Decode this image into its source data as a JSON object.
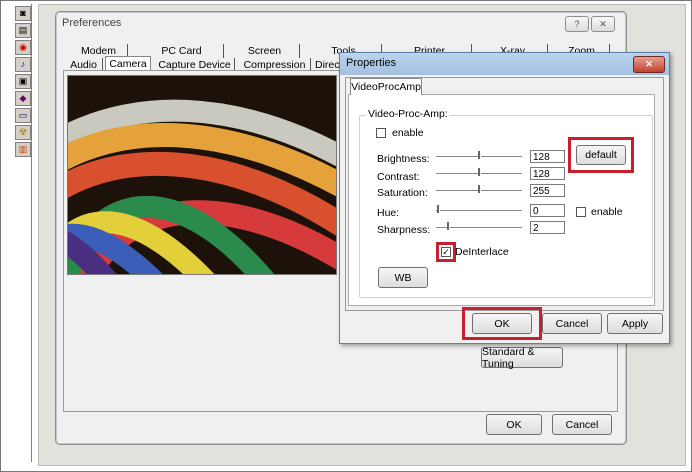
{
  "preferences": {
    "title": "Preferences",
    "help_btn": "?",
    "close_btn": "✕",
    "tabs_row1": [
      "Modem",
      "PC Card",
      "Screen",
      "Tools",
      "Printer",
      "X-ray",
      "Zoom"
    ],
    "tabs_row2": [
      "Audio",
      "Camera",
      "Capture Device",
      "Compression",
      "Direc"
    ],
    "active_tab": "Camera",
    "standard_btn": "Standard & Tuning",
    "ok_btn": "OK",
    "cancel_btn": "Cancel"
  },
  "properties": {
    "title": "Properties",
    "close_btn": "✕",
    "tab": "VideoProcAmp",
    "group_label": "Video-Proc-Amp:",
    "enable_label": "enable",
    "default_btn": "default",
    "sliders": [
      {
        "label": "Brightness:",
        "value": "128"
      },
      {
        "label": "Contrast:",
        "value": "128"
      },
      {
        "label": "Saturation:",
        "value": "255"
      },
      {
        "label": "Hue:",
        "value": "0"
      },
      {
        "label": "Sharpness:",
        "value": "2"
      }
    ],
    "hue_enable_label": "enable",
    "deinterlace_label": "DeInterlace",
    "deinterlace_checked": true,
    "wb_btn": "WB",
    "ok_btn": "OK",
    "cancel_btn": "Cancel",
    "apply_btn": "Apply"
  },
  "toolbar_icons": [
    "camera-icon",
    "film-icon",
    "lips-icon",
    "speaker-icon",
    "camcorder-icon",
    "wrench-icon",
    "monitor-icon",
    "radiation-icon",
    "chart-icon"
  ],
  "colors": {
    "highlight": "#c81e2e"
  }
}
